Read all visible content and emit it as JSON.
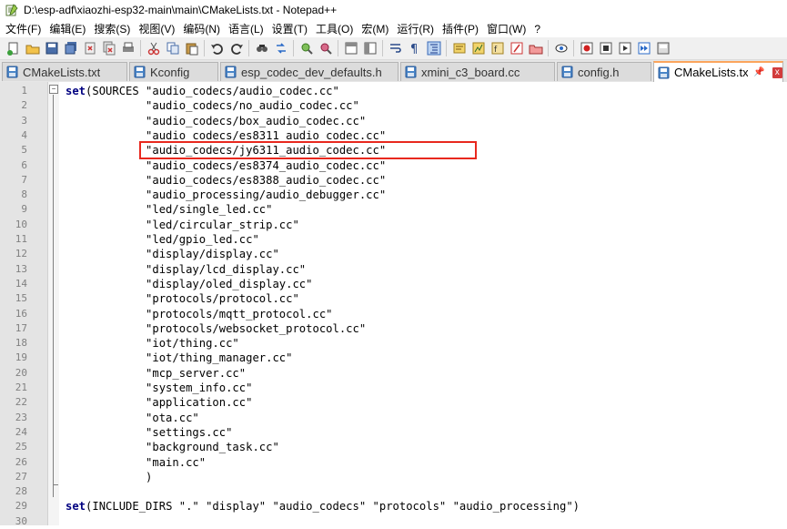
{
  "window": {
    "title": "D:\\esp-adf\\xiaozhi-esp32-main\\main\\CMakeLists.txt - Notepad++"
  },
  "menu": [
    "文件(F)",
    "编辑(E)",
    "搜索(S)",
    "视图(V)",
    "编码(N)",
    "语言(L)",
    "设置(T)",
    "工具(O)",
    "宏(M)",
    "运行(R)",
    "插件(P)",
    "窗口(W)",
    "?"
  ],
  "toolbar_icons": [
    "new-file-icon",
    "open-file-icon",
    "save-icon",
    "save-all-icon",
    "close-icon",
    "close-all-icon",
    "print-icon",
    "cut-icon",
    "copy-icon",
    "paste-icon",
    "undo-icon",
    "redo-icon",
    "find-icon",
    "replace-icon",
    "zoom-in-icon",
    "zoom-out-icon",
    "sync-vertical-icon",
    "sync-horizontal-icon",
    "word-wrap-icon",
    "show-all-chars-icon",
    "indent-guide-icon",
    "udl-icon",
    "doc-map-icon",
    "function-list-icon",
    "folder-workspace-icon",
    "doc-list-icon",
    "monitor-icon",
    "record-macro-icon",
    "stop-record-icon",
    "play-macro-icon",
    "run-macro-multiple-icon",
    "save-macro-icon"
  ],
  "tabs": [
    {
      "label": "CMakeLists.txt",
      "active": false
    },
    {
      "label": "Kconfig",
      "active": false
    },
    {
      "label": "esp_codec_dev_defaults.h",
      "active": false
    },
    {
      "label": "xmini_c3_board.cc",
      "active": false
    },
    {
      "label": "config.h",
      "active": false
    },
    {
      "label": "CMakeLists.txt",
      "active": true
    }
  ],
  "active_tab_pin": "📌",
  "active_tab_close": "x",
  "fold_toggle": "−",
  "code": [
    {
      "n": "1",
      "kw": "set",
      "rest": "(SOURCES \"audio_codecs/audio_codec.cc\""
    },
    {
      "n": "2",
      "kw": "",
      "rest": "            \"audio_codecs/no_audio_codec.cc\""
    },
    {
      "n": "3",
      "kw": "",
      "rest": "            \"audio_codecs/box_audio_codec.cc\""
    },
    {
      "n": "4",
      "kw": "",
      "rest": "            \"audio_codecs/es8311_audio_codec.cc\""
    },
    {
      "n": "5",
      "kw": "",
      "rest": "            \"audio_codecs/jy6311_audio_codec.cc\""
    },
    {
      "n": "6",
      "kw": "",
      "rest": "            \"audio_codecs/es8374_audio_codec.cc\""
    },
    {
      "n": "7",
      "kw": "",
      "rest": "            \"audio_codecs/es8388_audio_codec.cc\""
    },
    {
      "n": "8",
      "kw": "",
      "rest": "            \"audio_processing/audio_debugger.cc\""
    },
    {
      "n": "9",
      "kw": "",
      "rest": "            \"led/single_led.cc\""
    },
    {
      "n": "10",
      "kw": "",
      "rest": "            \"led/circular_strip.cc\""
    },
    {
      "n": "11",
      "kw": "",
      "rest": "            \"led/gpio_led.cc\""
    },
    {
      "n": "12",
      "kw": "",
      "rest": "            \"display/display.cc\""
    },
    {
      "n": "13",
      "kw": "",
      "rest": "            \"display/lcd_display.cc\""
    },
    {
      "n": "14",
      "kw": "",
      "rest": "            \"display/oled_display.cc\""
    },
    {
      "n": "15",
      "kw": "",
      "rest": "            \"protocols/protocol.cc\""
    },
    {
      "n": "16",
      "kw": "",
      "rest": "            \"protocols/mqtt_protocol.cc\""
    },
    {
      "n": "17",
      "kw": "",
      "rest": "            \"protocols/websocket_protocol.cc\""
    },
    {
      "n": "18",
      "kw": "",
      "rest": "            \"iot/thing.cc\""
    },
    {
      "n": "19",
      "kw": "",
      "rest": "            \"iot/thing_manager.cc\""
    },
    {
      "n": "20",
      "kw": "",
      "rest": "            \"mcp_server.cc\""
    },
    {
      "n": "21",
      "kw": "",
      "rest": "            \"system_info.cc\""
    },
    {
      "n": "22",
      "kw": "",
      "rest": "            \"application.cc\""
    },
    {
      "n": "23",
      "kw": "",
      "rest": "            \"ota.cc\""
    },
    {
      "n": "24",
      "kw": "",
      "rest": "            \"settings.cc\""
    },
    {
      "n": "25",
      "kw": "",
      "rest": "            \"background_task.cc\""
    },
    {
      "n": "26",
      "kw": "",
      "rest": "            \"main.cc\""
    },
    {
      "n": "27",
      "kw": "",
      "rest": "            )"
    },
    {
      "n": "28",
      "kw": "",
      "rest": ""
    },
    {
      "n": "29",
      "kw": "set",
      "rest": "(INCLUDE_DIRS \".\" \"display\" \"audio_codecs\" \"protocols\" \"audio_processing\")"
    },
    {
      "n": "30",
      "kw": "",
      "rest": ""
    }
  ],
  "highlighted_line": "5",
  "colors": {
    "keyword": "#000080",
    "highlight_border": "#e8281e",
    "active_tab_accent": "#fba55d"
  }
}
